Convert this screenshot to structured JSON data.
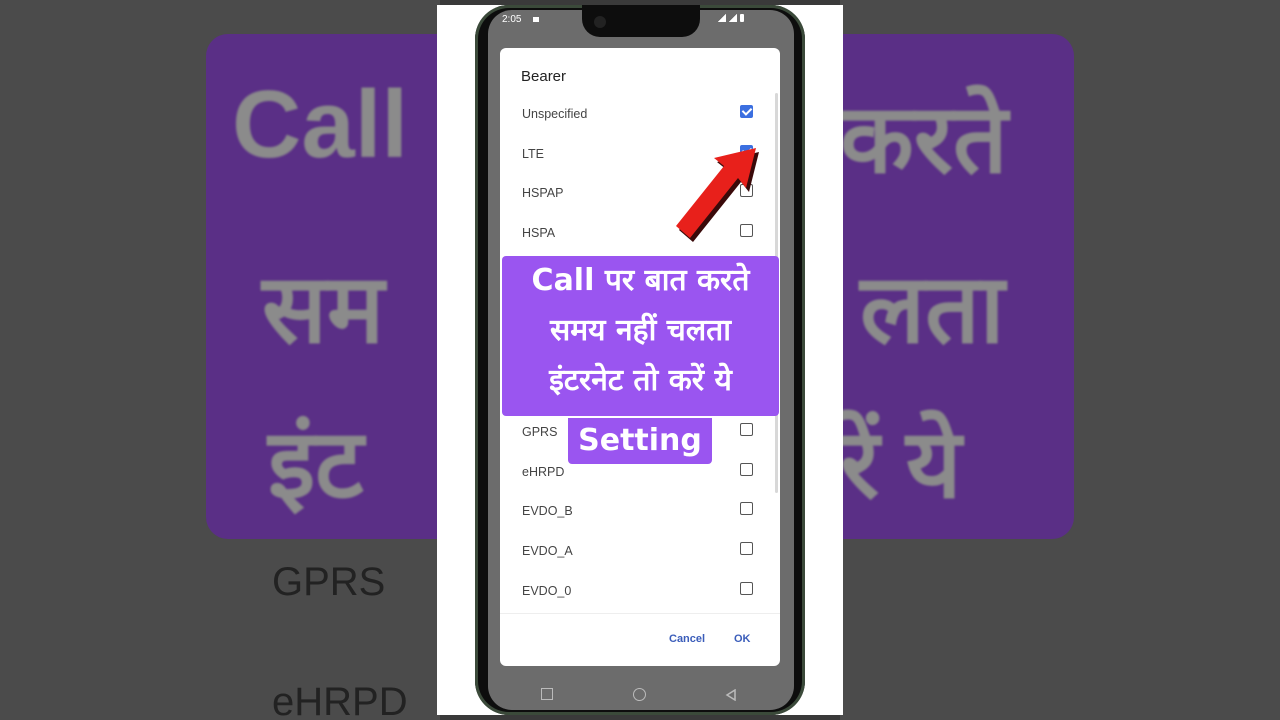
{
  "status_bar": {
    "time": "2:05"
  },
  "dialog": {
    "title": "Bearer",
    "options": [
      {
        "label": "Unspecified",
        "checked": true
      },
      {
        "label": "LTE",
        "checked": true
      },
      {
        "label": "HSPAP",
        "checked": false
      },
      {
        "label": "HSPA",
        "checked": false
      },
      {
        "label": "GPRS",
        "checked": false
      },
      {
        "label": "eHRPD",
        "checked": false
      },
      {
        "label": "EVDO_B",
        "checked": false
      },
      {
        "label": "EVDO_A",
        "checked": false
      },
      {
        "label": "EVDO_0",
        "checked": false
      }
    ],
    "cancel_label": "Cancel",
    "ok_label": "OK"
  },
  "overlay": {
    "line1": "Call पर बात करते",
    "line2": "समय नहीं चलता",
    "line3": "इंटरनेट तो करें ये",
    "line4": "Setting"
  },
  "background": {
    "left_text_1": "Call",
    "left_text_2": "सम",
    "left_text_3": "इंट",
    "right_text_1": "करते",
    "right_text_2": "लता",
    "right_text_3": "रें ये",
    "row_1": "GPRS",
    "row_2": "eHRPD"
  },
  "colors": {
    "accent": "#3b6fe0",
    "overlay": "#9a55f0",
    "button": "#3b5dba",
    "arrow": "#e8201b"
  }
}
